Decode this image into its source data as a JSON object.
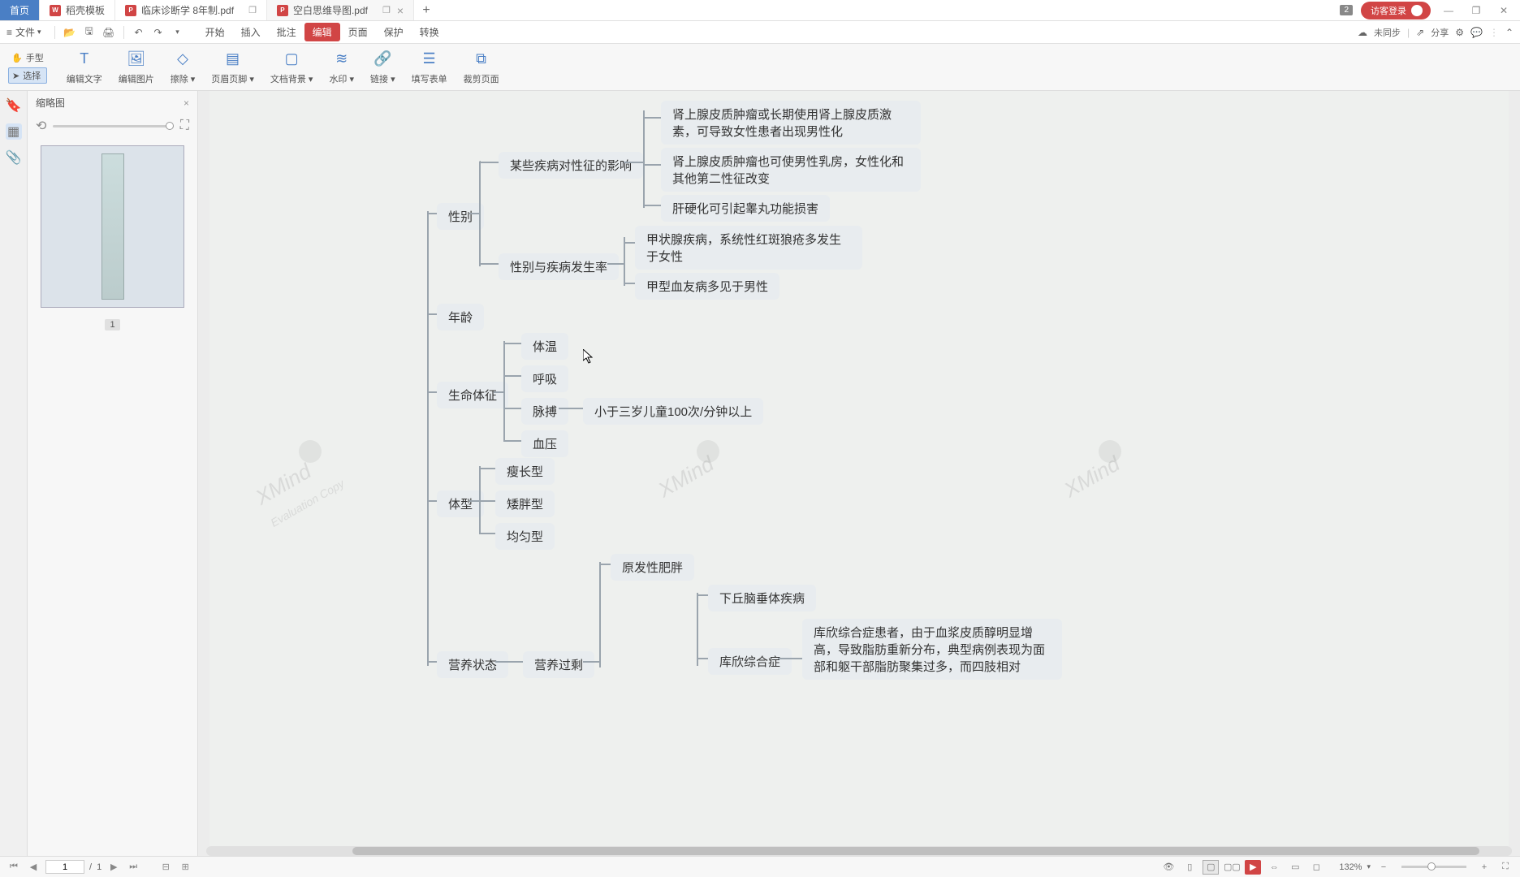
{
  "titlebar": {
    "home": "首页",
    "tabs": [
      {
        "label": "稻壳模板"
      },
      {
        "label": "临床诊断学 8年制.pdf"
      },
      {
        "label": "空白思维导图.pdf"
      }
    ],
    "badge": "2",
    "login": "访客登录"
  },
  "menubar": {
    "file": "文件",
    "items": [
      "开始",
      "插入",
      "批注",
      "编辑",
      "页面",
      "保护",
      "转换"
    ],
    "unsync": "未同步",
    "share": "分享"
  },
  "toolbar": {
    "hand": "手型",
    "select": "选择",
    "buttons": [
      "编辑文字",
      "编辑图片",
      "擦除",
      "页眉页脚",
      "文档背景",
      "水印",
      "链接",
      "填写表单",
      "裁剪页面"
    ]
  },
  "thumbpanel": {
    "title": "缩略图",
    "page": "1"
  },
  "mindmap": {
    "n_gender": "性别",
    "n_disease_effect": "某些疾病对性征的影响",
    "n_adrenal1": "肾上腺皮质肿瘤或长期使用肾上腺皮质激素，可导致女性患者出现男性化",
    "n_adrenal2": "肾上腺皮质肿瘤也可使男性乳房，女性化和其他第二性征改变",
    "n_liver": "肝硬化可引起睾丸功能损害",
    "n_gender_rate": "性别与疾病发生率",
    "n_thyroid": "甲状腺疾病，系统性红斑狼疮多发生于女性",
    "n_hemophilia": "甲型血友病多见于男性",
    "n_age": "年龄",
    "n_vital": "生命体征",
    "n_temp": "体温",
    "n_breath": "呼吸",
    "n_pulse": "脉搏",
    "n_pulse_note": "小于三岁儿童100次/分钟以上",
    "n_bp": "血压",
    "n_bodytype": "体型",
    "n_slim": "瘦长型",
    "n_short": "矮胖型",
    "n_even": "均匀型",
    "n_nutrition": "营养状态",
    "n_overnut": "营养过剩",
    "n_primary_ob": "原发性肥胖",
    "n_hypothalamus": "下丘脑垂体疾病",
    "n_cushing": "库欣综合症",
    "n_cushing_desc": "库欣综合症患者，由于血浆皮质醇明显增高，导致脂肪重新分布，典型病例表现为面部和躯干部脂肪聚集过多，而四肢相对"
  },
  "statusbar": {
    "page_current": "1",
    "page_total": "1",
    "zoom": "132%"
  }
}
